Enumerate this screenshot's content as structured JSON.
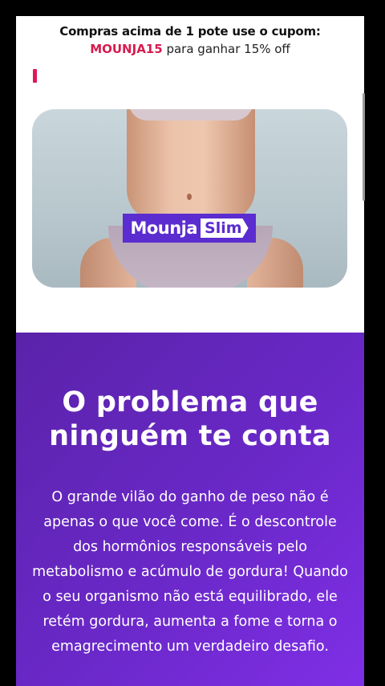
{
  "banner": {
    "line1": "Compras acima de 1 pote use o cupom:",
    "coupon": "MOUNJA15",
    "line2_rest": " para ganhar 15% off"
  },
  "hero": {
    "image_icon": "product-hero-photo",
    "brand_name": "Mounja",
    "brand_sub": "Slim"
  },
  "problem": {
    "title_line1": "O problema que",
    "title_line2": "ninguém te conta",
    "body": "O grande vilão do ganho de peso não é apenas o que você come. É o descontrole dos hormônios responsáveis pelo metabolismo e acúmulo de gordura! Quando o seu organismo não está equilibrado, ele retém gordura, aumenta a fome e torna o emagrecimento um verdadeiro desafio."
  },
  "colors": {
    "accent_pink": "#d81b4f",
    "brand_purple": "#5b2ccf",
    "section_gradient_start": "#5a23a9",
    "section_gradient_end": "#7f2fe6"
  }
}
